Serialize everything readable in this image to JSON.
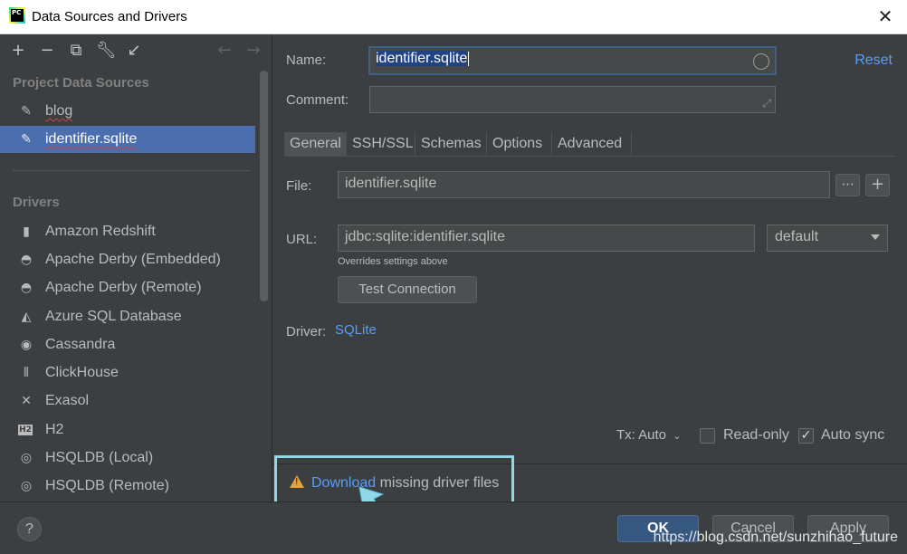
{
  "window": {
    "title": "Data Sources and Drivers",
    "app_icon_text": "PC"
  },
  "left": {
    "project_header": "Project Data Sources",
    "project_items": [
      {
        "label": "blog"
      },
      {
        "label": "identifier.sqlite"
      }
    ],
    "drivers_header": "Drivers",
    "drivers": [
      "Amazon Redshift",
      "Apache Derby (Embedded)",
      "Apache Derby (Remote)",
      "Azure SQL Database",
      "Cassandra",
      "ClickHouse",
      "Exasol",
      "H2",
      "HSQLDB (Local)",
      "HSQLDB (Remote)"
    ]
  },
  "form": {
    "name_label": "Name:",
    "name_value": "identifier.sqlite",
    "comment_label": "Comment:",
    "reset": "Reset",
    "tabs": [
      "General",
      "SSH/SSL",
      "Schemas",
      "Options",
      "Advanced"
    ],
    "file_label": "File:",
    "file_value": "identifier.sqlite",
    "file_browse": "···",
    "file_add": "+",
    "url_label": "URL:",
    "url_value": "jdbc:sqlite:identifier.sqlite",
    "url_mode": "default",
    "url_hint": "Overrides settings above",
    "test_connection": "Test Connection",
    "driver_label": "Driver:",
    "driver_value": "SQLite",
    "tx_label": "Tx: Auto",
    "readonly_label": "Read-only",
    "autosync_label": "Auto sync",
    "autosync_check": "✓"
  },
  "warning": {
    "link": "Download",
    "text": " missing driver files"
  },
  "footer": {
    "help": "?",
    "ok": "OK",
    "cancel": "Cancel",
    "apply": "Apply"
  },
  "watermark": "https://blog.csdn.net/sunzhihao_future",
  "colors": {
    "accent": "#589df6",
    "selection": "#4b6eaf",
    "highlight_box": "#8fd8e8",
    "warning": "#e8a33d"
  }
}
